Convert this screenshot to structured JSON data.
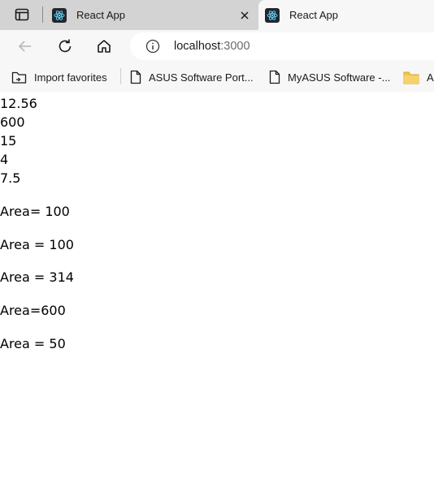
{
  "tabs": [
    {
      "title": "React App",
      "active": false
    },
    {
      "title": "React App",
      "active": true
    }
  ],
  "address": {
    "host": "localhost",
    "port": ":3000"
  },
  "favorites": [
    {
      "label": "Import favorites",
      "icon": "import-icon"
    },
    {
      "label": "ASUS Software Port...",
      "icon": "page-icon"
    },
    {
      "label": "MyASUS Software -...",
      "icon": "page-icon"
    },
    {
      "label": "AS",
      "icon": "folder-icon"
    }
  ],
  "content": {
    "values": [
      "12.56",
      "600",
      "15",
      "4",
      "7.5"
    ],
    "areas": [
      "Area= 100",
      "Area = 100",
      "Area = 314",
      "Area=600",
      "Area = 50"
    ]
  }
}
